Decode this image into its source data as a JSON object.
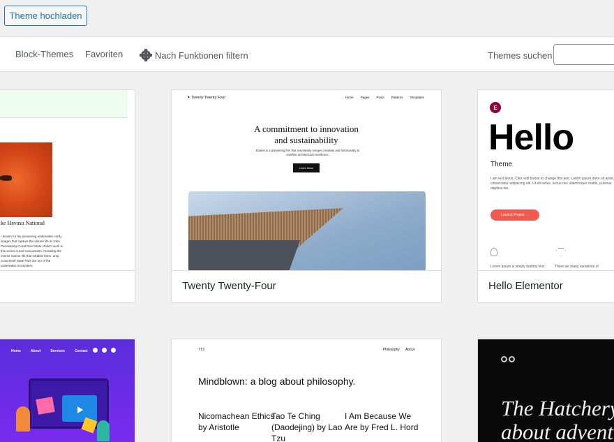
{
  "upload_button": "Theme hochladen",
  "filters": {
    "block_themes": "Block-Themes",
    "favorites": "Favoriten",
    "feature_filter": "Nach Funktionen filtern",
    "search_label": "Themes suchen",
    "search_value": ""
  },
  "cards": {
    "partial_left": {
      "photo_caption": "ke Havasu National",
      "text": "r known for his pioneering underwater cordy images that capture the vibrant life at John Pennekamp Coral Reef State chula's work in this series is and composition, revealing the everse marine life that inhabits them. amp Coral Reef State Park are ion of the underwater ecosystem,"
    },
    "twenty_twenty_four": {
      "name": "Twenty Twenty-Four",
      "brand": "Twenty Twenty Four",
      "nav": [
        "Home",
        "Pages",
        "Posts",
        "Patterns",
        "Templates"
      ],
      "headline_line1": "A commitment to innovation",
      "headline_line2": "and sustainability",
      "sub": "Études is a pioneering firm that seamlessly merges creativity and functionality to redefine architectural excellence.",
      "cta": "Learn More"
    },
    "hello_elementor": {
      "name": "Hello Elementor",
      "logo": "E",
      "hello": "Hello",
      "theme": "Theme",
      "text": "I am text block. Click edit button to change this text. Lorem ipsum dolor sit amet, consectetur adipiscing elit. Ut elit tellus, luctus nec ullamcorper mattis, pulvinar dapibus leo.",
      "button": "Launch Project →",
      "caption1": "Lorem Ipsum is simply dummy text",
      "caption2": "There we many variations of"
    },
    "purple": {
      "nav": [
        "Home",
        "About",
        "Services",
        "Contact"
      ]
    },
    "twenty_twenty_three": {
      "brand": "TT3",
      "nav": [
        "Philosophy",
        "About"
      ],
      "headline": "Mindblown: a blog about philosophy.",
      "posts": [
        "Nicomachean Ethics by Aristotle",
        "Tao Te Ching (Daodejing) by Lao Tzu",
        "I Am Because We Are by Fred L. Hord"
      ]
    },
    "dark": {
      "title_line1": "The Hatchery:",
      "title_line2": "about adventur"
    }
  },
  "colors": {
    "accent": "#2271b1",
    "elementor_brand": "#92003b",
    "elementor_button": "#f05a4f"
  }
}
